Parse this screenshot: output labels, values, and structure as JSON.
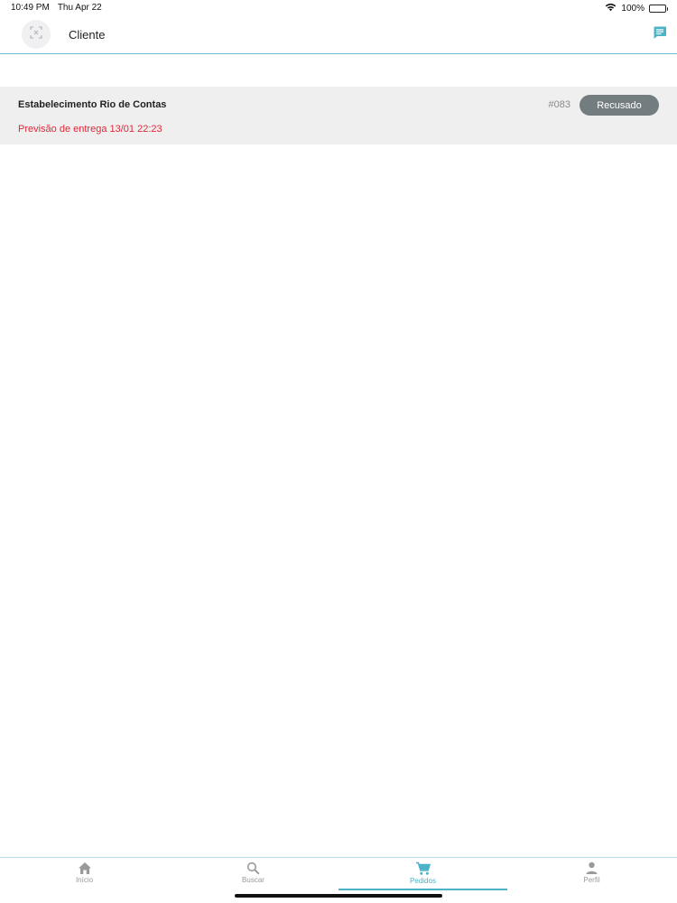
{
  "status_bar": {
    "time": "10:49 PM",
    "date": "Thu Apr 22",
    "battery": "100%",
    "icons": [
      "wifi-icon",
      "battery-icon"
    ]
  },
  "header": {
    "title": "Cliente",
    "logo_icon": "image-placeholder-icon",
    "chat_icon": "chat-icon"
  },
  "orders": [
    {
      "store": "Estabelecimento Rio de Contas",
      "number": "#083",
      "status": "Recusado",
      "delivery_estimate": "Previsão de entrega 13/01 22:23"
    }
  ],
  "tabs": [
    {
      "label": "Início",
      "icon": "home-icon",
      "active": false
    },
    {
      "label": "Buscar",
      "icon": "search-icon",
      "active": false
    },
    {
      "label": "Pedidos",
      "icon": "cart-icon",
      "active": true
    },
    {
      "label": "Perfil",
      "icon": "person-icon",
      "active": false
    }
  ],
  "colors": {
    "accent": "#4bb3c8",
    "status_pill": "#737d80",
    "eta_text": "#e0283a",
    "card_bg": "#efefef"
  }
}
